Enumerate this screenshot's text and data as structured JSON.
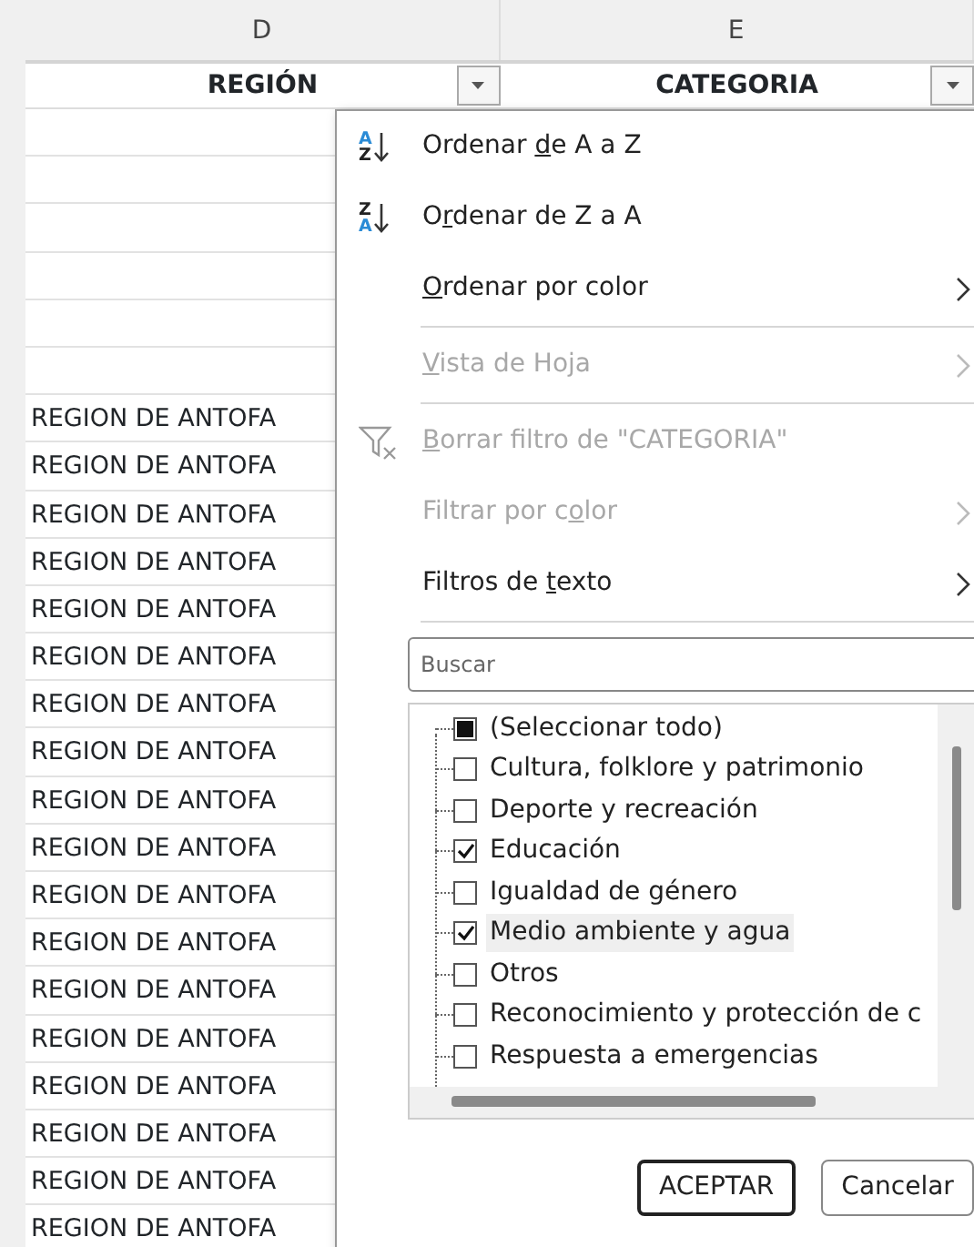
{
  "columns": [
    {
      "letter": "D",
      "heading": "REGIÓN"
    },
    {
      "letter": "E",
      "heading": "CATEGORIA"
    }
  ],
  "rows": [
    {
      "region": ""
    },
    {
      "region": ""
    },
    {
      "region": ""
    },
    {
      "region": ""
    },
    {
      "region": ""
    },
    {
      "region": ""
    },
    {
      "region": "REGION DE ANTOFA"
    },
    {
      "region": "REGION DE ANTOFA"
    },
    {
      "region": "REGION DE ANTOFA"
    },
    {
      "region": "REGION DE ANTOFA"
    },
    {
      "region": "REGION DE ANTOFA"
    },
    {
      "region": "REGION DE ANTOFA"
    },
    {
      "region": "REGION DE ANTOFA"
    },
    {
      "region": "REGION DE ANTOFA"
    },
    {
      "region": "REGION DE ANTOFA"
    },
    {
      "region": "REGION DE ANTOFA"
    },
    {
      "region": "REGION DE ANTOFA"
    },
    {
      "region": "REGION DE ANTOFA"
    },
    {
      "region": "REGION DE ANTOFA"
    },
    {
      "region": "REGION DE ANTOFA"
    },
    {
      "region": "REGION DE ANTOFA"
    },
    {
      "region": "REGION DE ANTOFA"
    },
    {
      "region": "REGION DE ANTOFA"
    },
    {
      "region": "REGION DE ANTOFA"
    }
  ],
  "menu": {
    "items": [
      {
        "kind": "sort",
        "icon_top": "A",
        "icon_bottom": "Z",
        "prefix": "Ordenar ",
        "access_key": "d",
        "rest": "e A a Z",
        "disabled": false,
        "submenu": false
      },
      {
        "kind": "sort",
        "icon_top": "Z",
        "icon_bottom": "A",
        "prefix": "O",
        "access_key": "r",
        "rest": "denar de Z a A",
        "disabled": false,
        "submenu": false
      },
      {
        "kind": "plain",
        "access_key": "O",
        "rest": "rdenar por color",
        "disabled": false,
        "submenu": true
      },
      {
        "kind": "separator"
      },
      {
        "kind": "plain",
        "access_key": "V",
        "rest": "ista de Hoja",
        "disabled": true,
        "submenu": true
      },
      {
        "kind": "separator"
      },
      {
        "kind": "clear-filter",
        "access_key": "B",
        "rest": "orrar filtro de \"CATEGORIA\"",
        "disabled": true,
        "submenu": false
      },
      {
        "kind": "plain",
        "prefix": "Filtrar por c",
        "access_key": "o",
        "rest": "lor",
        "disabled": true,
        "submenu": true
      },
      {
        "kind": "plain",
        "prefix": "Filtros de ",
        "access_key": "t",
        "rest": "exto",
        "disabled": false,
        "submenu": true
      },
      {
        "kind": "separator"
      }
    ],
    "search": {
      "placeholder": "Buscar"
    },
    "values": [
      {
        "label": "(Seleccionar todo)",
        "checked": false,
        "mixed": true,
        "selected": false
      },
      {
        "label": "Cultura, folklore y patrimonio",
        "checked": false,
        "mixed": false,
        "selected": false
      },
      {
        "label": "Deporte y recreación",
        "checked": false,
        "mixed": false,
        "selected": false
      },
      {
        "label": "Educación",
        "checked": true,
        "mixed": false,
        "selected": false
      },
      {
        "label": "Igualdad de género",
        "checked": false,
        "mixed": false,
        "selected": false
      },
      {
        "label": "Medio ambiente y agua",
        "checked": true,
        "mixed": false,
        "selected": true
      },
      {
        "label": "Otros",
        "checked": false,
        "mixed": false,
        "selected": false
      },
      {
        "label": "Reconocimiento y protección de c",
        "checked": false,
        "mixed": false,
        "selected": false
      },
      {
        "label": "Respuesta a emergencias",
        "checked": false,
        "mixed": false,
        "selected": false
      }
    ],
    "buttons": [
      {
        "label": "ACEPTAR",
        "default": true
      },
      {
        "label": "Cancelar",
        "default": false
      }
    ]
  }
}
